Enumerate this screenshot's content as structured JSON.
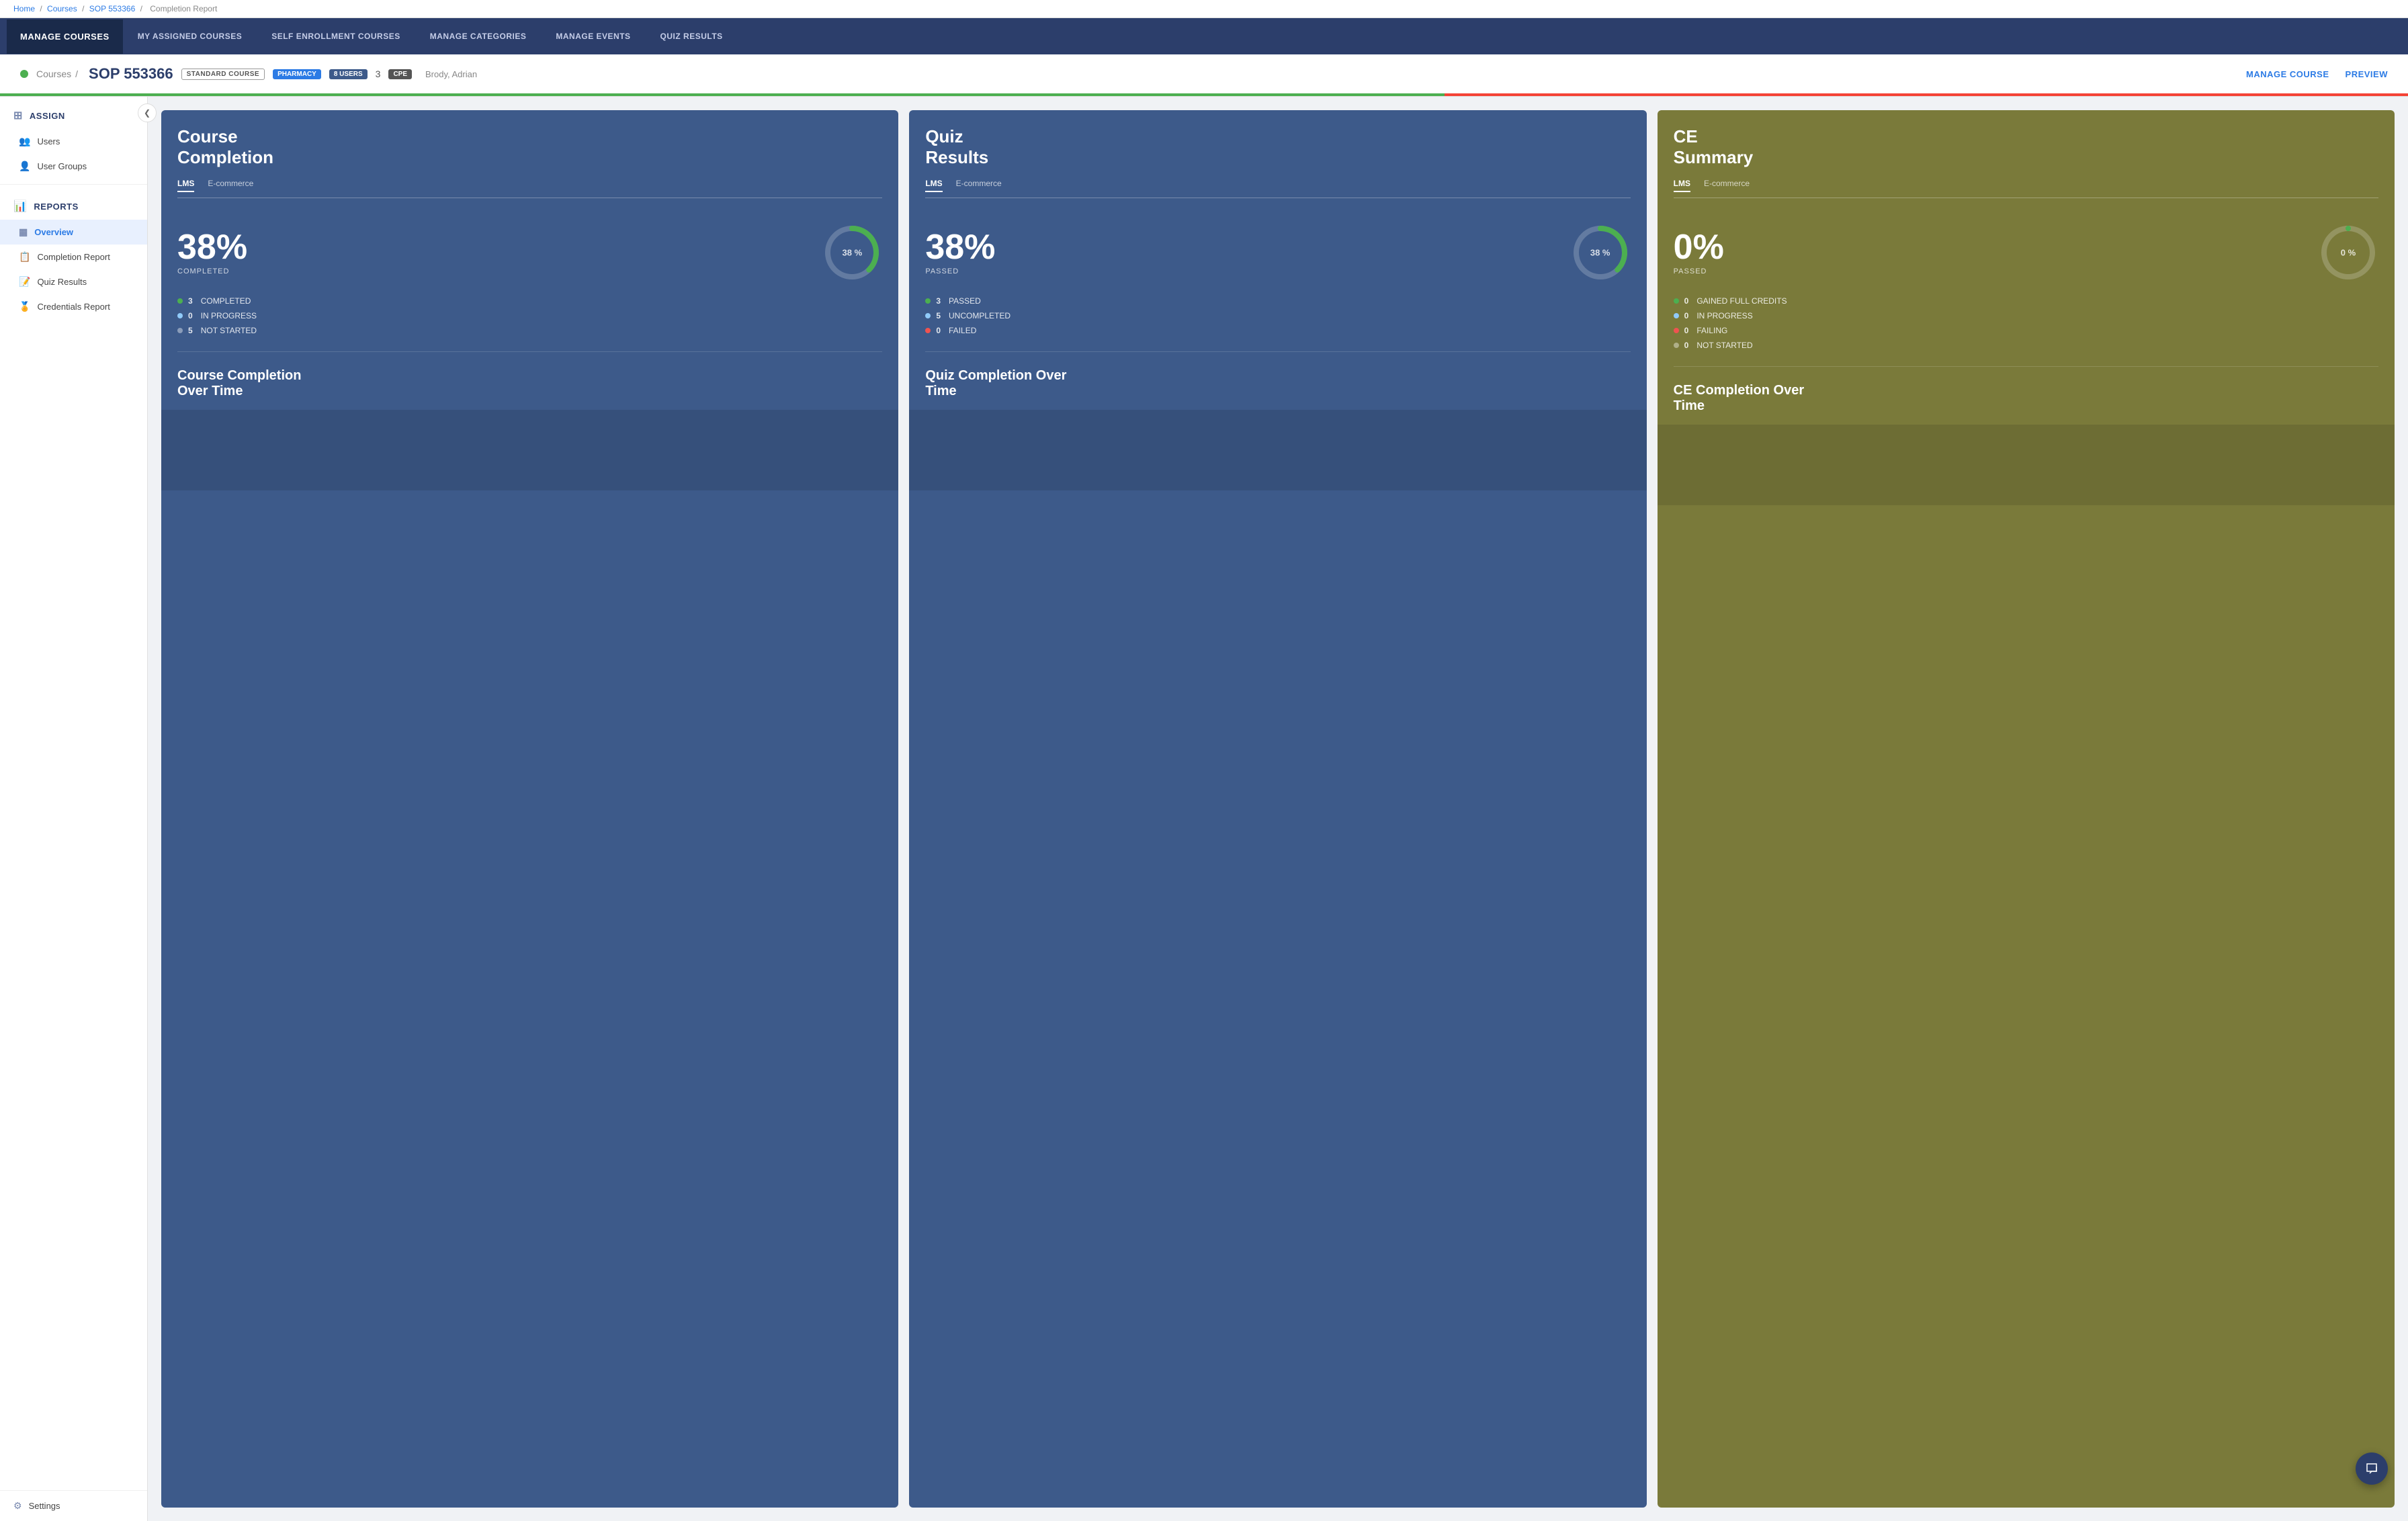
{
  "breadcrumb": {
    "home": "Home",
    "courses": "Courses",
    "course_id": "SOP 553366",
    "current": "Completion Report",
    "separator": "/"
  },
  "nav": {
    "brand": "MANAGE COURSES",
    "tabs": [
      {
        "label": "MY ASSIGNED COURSES",
        "active": false
      },
      {
        "label": "SELF ENROLLMENT COURSES",
        "active": false
      },
      {
        "label": "MANAGE CATEGORIES",
        "active": false
      },
      {
        "label": "MANAGE EVENTS",
        "active": false
      },
      {
        "label": "QUIZ RESULTS",
        "active": false
      }
    ]
  },
  "course_header": {
    "status": "active",
    "path_prefix": "Courses",
    "course_name": "SOP 553366",
    "badge_standard": "STANDARD COURSE",
    "badge_pharmacy": "PHARMACY",
    "badge_users": "8 USERS",
    "cpe_count": "3",
    "badge_cpe": "CPE",
    "author": "Brody, Adrian",
    "action_manage": "MANAGE COURSE",
    "action_preview": "PREVIEW"
  },
  "sidebar": {
    "assign_label": "ASSIGN",
    "assign_icon": "⊞",
    "users_label": "Users",
    "users_icon": "👥",
    "usergroups_label": "User Groups",
    "usergroups_icon": "👤",
    "reports_label": "REPORTS",
    "reports_icon": "📊",
    "overview_label": "Overview",
    "overview_icon": "▦",
    "completion_label": "Completion Report",
    "completion_icon": "📋",
    "quiz_label": "Quiz Results",
    "quiz_icon": "📝",
    "credentials_label": "Credentials Report",
    "credentials_icon": "🏅",
    "settings_label": "Settings",
    "settings_icon": "⚙"
  },
  "cards": {
    "course_completion": {
      "title": "Course\nCompletion",
      "tabs": [
        "LMS",
        "E-commerce"
      ],
      "active_tab": "LMS",
      "percent": "38%",
      "percent_label": "COMPLETED",
      "circle_label": "38 %",
      "stats": [
        {
          "color": "green",
          "count": "3",
          "label": "COMPLETED"
        },
        {
          "color": "blue",
          "count": "0",
          "label": "IN PROGRESS"
        },
        {
          "color": "gray",
          "count": "5",
          "label": "NOT STARTED"
        }
      ],
      "over_time_title": "Course Completion\nOver Time"
    },
    "quiz_results": {
      "title": "Quiz\nResults",
      "tabs": [
        "LMS",
        "E-commerce"
      ],
      "active_tab": "LMS",
      "percent": "38%",
      "percent_label": "PASSED",
      "circle_label": "38 %",
      "stats": [
        {
          "color": "green",
          "count": "3",
          "label": "PASSED"
        },
        {
          "color": "blue",
          "count": "5",
          "label": "UNCOMPLETED"
        },
        {
          "color": "red",
          "count": "0",
          "label": "FAILED"
        }
      ],
      "over_time_title": "Quiz Completion Over\nTime"
    },
    "ce_summary": {
      "title": "CE\nSummary",
      "tabs": [
        "LMS",
        "E-commerce"
      ],
      "active_tab": "LMS",
      "percent": "0%",
      "percent_label": "PASSED",
      "circle_label": "0 %",
      "stats": [
        {
          "color": "green",
          "count": "0",
          "label": "GAINED FULL CREDITS"
        },
        {
          "color": "blue",
          "count": "0",
          "label": "IN PROGRESS"
        },
        {
          "color": "red",
          "count": "0",
          "label": "FAILING"
        },
        {
          "color": "gray",
          "count": "0",
          "label": "NOT STARTED"
        }
      ],
      "over_time_title": "CE Completion Over\nTime"
    }
  },
  "colors": {
    "card_blue": "#3d5a8a",
    "card_olive": "#7a7a3a",
    "accent": "#2c7be5",
    "green": "#4caf50",
    "red": "#ef5350",
    "blue_dot": "#90caf9"
  }
}
